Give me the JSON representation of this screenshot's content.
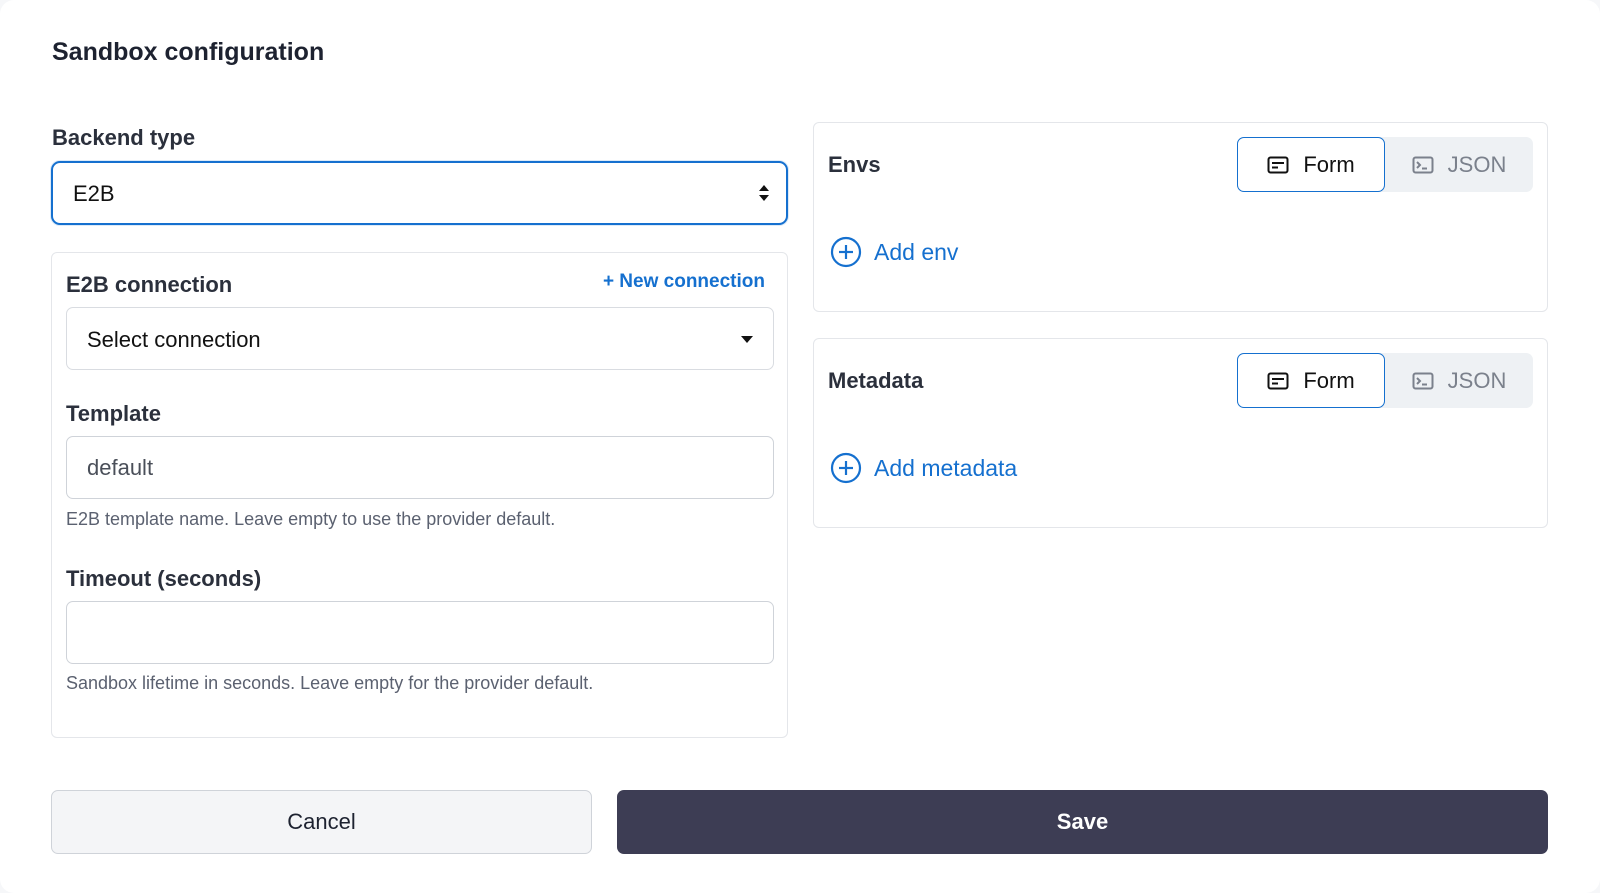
{
  "dialog": {
    "title": "Sandbox configuration"
  },
  "backend": {
    "label": "Backend type",
    "value": "E2B"
  },
  "connection": {
    "label": "E2B connection",
    "new_link": "+ New connection",
    "value": "Select connection"
  },
  "template": {
    "label": "Template",
    "placeholder": "default",
    "value": "",
    "help": "E2B template name. Leave empty to use the provider default."
  },
  "timeout": {
    "label": "Timeout (seconds)",
    "placeholder": "",
    "value": "",
    "help": "Sandbox lifetime in seconds. Leave empty for the provider default."
  },
  "envs": {
    "title": "Envs",
    "mode_form": "Form",
    "mode_json": "JSON",
    "selected_mode": "Form",
    "add_label": "Add env"
  },
  "metadata": {
    "title": "Metadata",
    "mode_form": "Form",
    "mode_json": "JSON",
    "selected_mode": "Form",
    "add_label": "Add metadata"
  },
  "footer": {
    "cancel_label": "Cancel",
    "save_label": "Save"
  },
  "colors": {
    "accent": "#1570cf",
    "save_bg": "#3d3d54",
    "text": "#1f2430",
    "muted": "#5b6170"
  },
  "icons": {
    "form": "form-icon",
    "json": "terminal-icon",
    "add": "plus-circle-icon",
    "select_updown": "updown-arrows-icon",
    "select_caret": "chevron-down-icon"
  }
}
